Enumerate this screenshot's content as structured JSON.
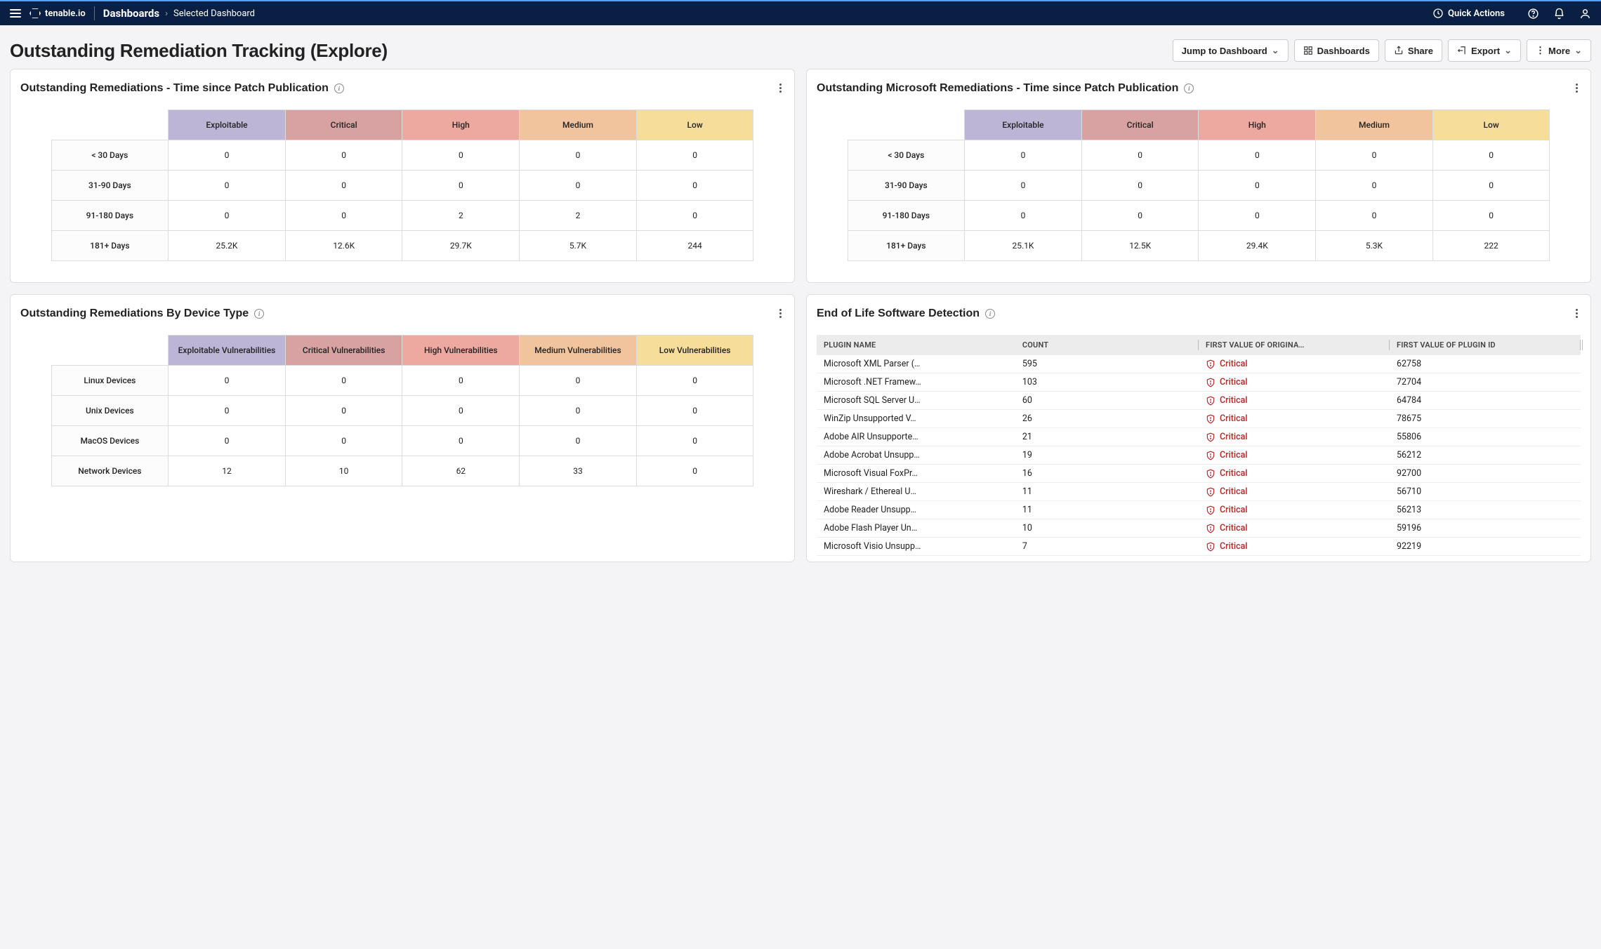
{
  "nav": {
    "brand": "tenable.io",
    "breadcrumb_root": "Dashboards",
    "breadcrumb_leaf": "Selected Dashboard",
    "quick_actions": "Quick Actions"
  },
  "page": {
    "title": "Outstanding Remediation Tracking (Explore)",
    "buttons": {
      "jump": "Jump to Dashboard",
      "dashboards": "Dashboards",
      "share": "Share",
      "export": "Export",
      "more": "More"
    }
  },
  "card1": {
    "title": "Outstanding Remediations - Time since Patch Publication",
    "cols": [
      "Exploitable",
      "Critical",
      "High",
      "Medium",
      "Low"
    ],
    "rows": [
      {
        "label": "< 30 Days",
        "vals": [
          "0",
          "0",
          "0",
          "0",
          "0"
        ]
      },
      {
        "label": "31-90 Days",
        "vals": [
          "0",
          "0",
          "0",
          "0",
          "0"
        ]
      },
      {
        "label": "91-180 Days",
        "vals": [
          "0",
          "0",
          "2",
          "2",
          "0"
        ]
      },
      {
        "label": "181+ Days",
        "vals": [
          "25.2K",
          "12.6K",
          "29.7K",
          "5.7K",
          "244"
        ]
      }
    ]
  },
  "card2": {
    "title": "Outstanding Microsoft Remediations - Time since Patch Publication",
    "cols": [
      "Exploitable",
      "Critical",
      "High",
      "Medium",
      "Low"
    ],
    "rows": [
      {
        "label": "< 30 Days",
        "vals": [
          "0",
          "0",
          "0",
          "0",
          "0"
        ]
      },
      {
        "label": "31-90 Days",
        "vals": [
          "0",
          "0",
          "0",
          "0",
          "0"
        ]
      },
      {
        "label": "91-180 Days",
        "vals": [
          "0",
          "0",
          "0",
          "0",
          "0"
        ]
      },
      {
        "label": "181+ Days",
        "vals": [
          "25.1K",
          "12.5K",
          "29.4K",
          "5.3K",
          "222"
        ]
      }
    ]
  },
  "card3": {
    "title": "Outstanding Remediations By Device Type",
    "cols": [
      "Exploitable Vulnerabilities",
      "Critical Vulnerabilities",
      "High Vulnerabilities",
      "Medium Vulnerabilities",
      "Low Vulnerabilities"
    ],
    "rows": [
      {
        "label": "Linux Devices",
        "vals": [
          "0",
          "0",
          "0",
          "0",
          "0"
        ]
      },
      {
        "label": "Unix Devices",
        "vals": [
          "0",
          "0",
          "0",
          "0",
          "0"
        ]
      },
      {
        "label": "MacOS Devices",
        "vals": [
          "0",
          "0",
          "0",
          "0",
          "0"
        ]
      },
      {
        "label": "Network Devices",
        "vals": [
          "12",
          "10",
          "62",
          "33",
          "0"
        ]
      }
    ]
  },
  "card4": {
    "title": "End of Life Software Detection",
    "columns": [
      "PLUGIN NAME",
      "COUNT",
      "FIRST VALUE OF ORIGINA…",
      "FIRST VALUE OF PLUGIN ID"
    ],
    "rows": [
      {
        "name": "Microsoft XML Parser (…",
        "count": "595",
        "sev": "Critical",
        "id": "62758"
      },
      {
        "name": "Microsoft .NET Framew…",
        "count": "103",
        "sev": "Critical",
        "id": "72704"
      },
      {
        "name": "Microsoft SQL Server U…",
        "count": "60",
        "sev": "Critical",
        "id": "64784"
      },
      {
        "name": "WinZip Unsupported V…",
        "count": "26",
        "sev": "Critical",
        "id": "78675"
      },
      {
        "name": "Adobe AIR Unsupporte…",
        "count": "21",
        "sev": "Critical",
        "id": "55806"
      },
      {
        "name": "Adobe Acrobat Unsupp…",
        "count": "19",
        "sev": "Critical",
        "id": "56212"
      },
      {
        "name": "Microsoft Visual FoxPr…",
        "count": "16",
        "sev": "Critical",
        "id": "92700"
      },
      {
        "name": "Wireshark / Ethereal U…",
        "count": "11",
        "sev": "Critical",
        "id": "56710"
      },
      {
        "name": "Adobe Reader Unsupp…",
        "count": "11",
        "sev": "Critical",
        "id": "56213"
      },
      {
        "name": "Adobe Flash Player Un…",
        "count": "10",
        "sev": "Critical",
        "id": "59196"
      },
      {
        "name": "Microsoft Visio Unsupp…",
        "count": "7",
        "sev": "Critical",
        "id": "92219"
      }
    ]
  }
}
